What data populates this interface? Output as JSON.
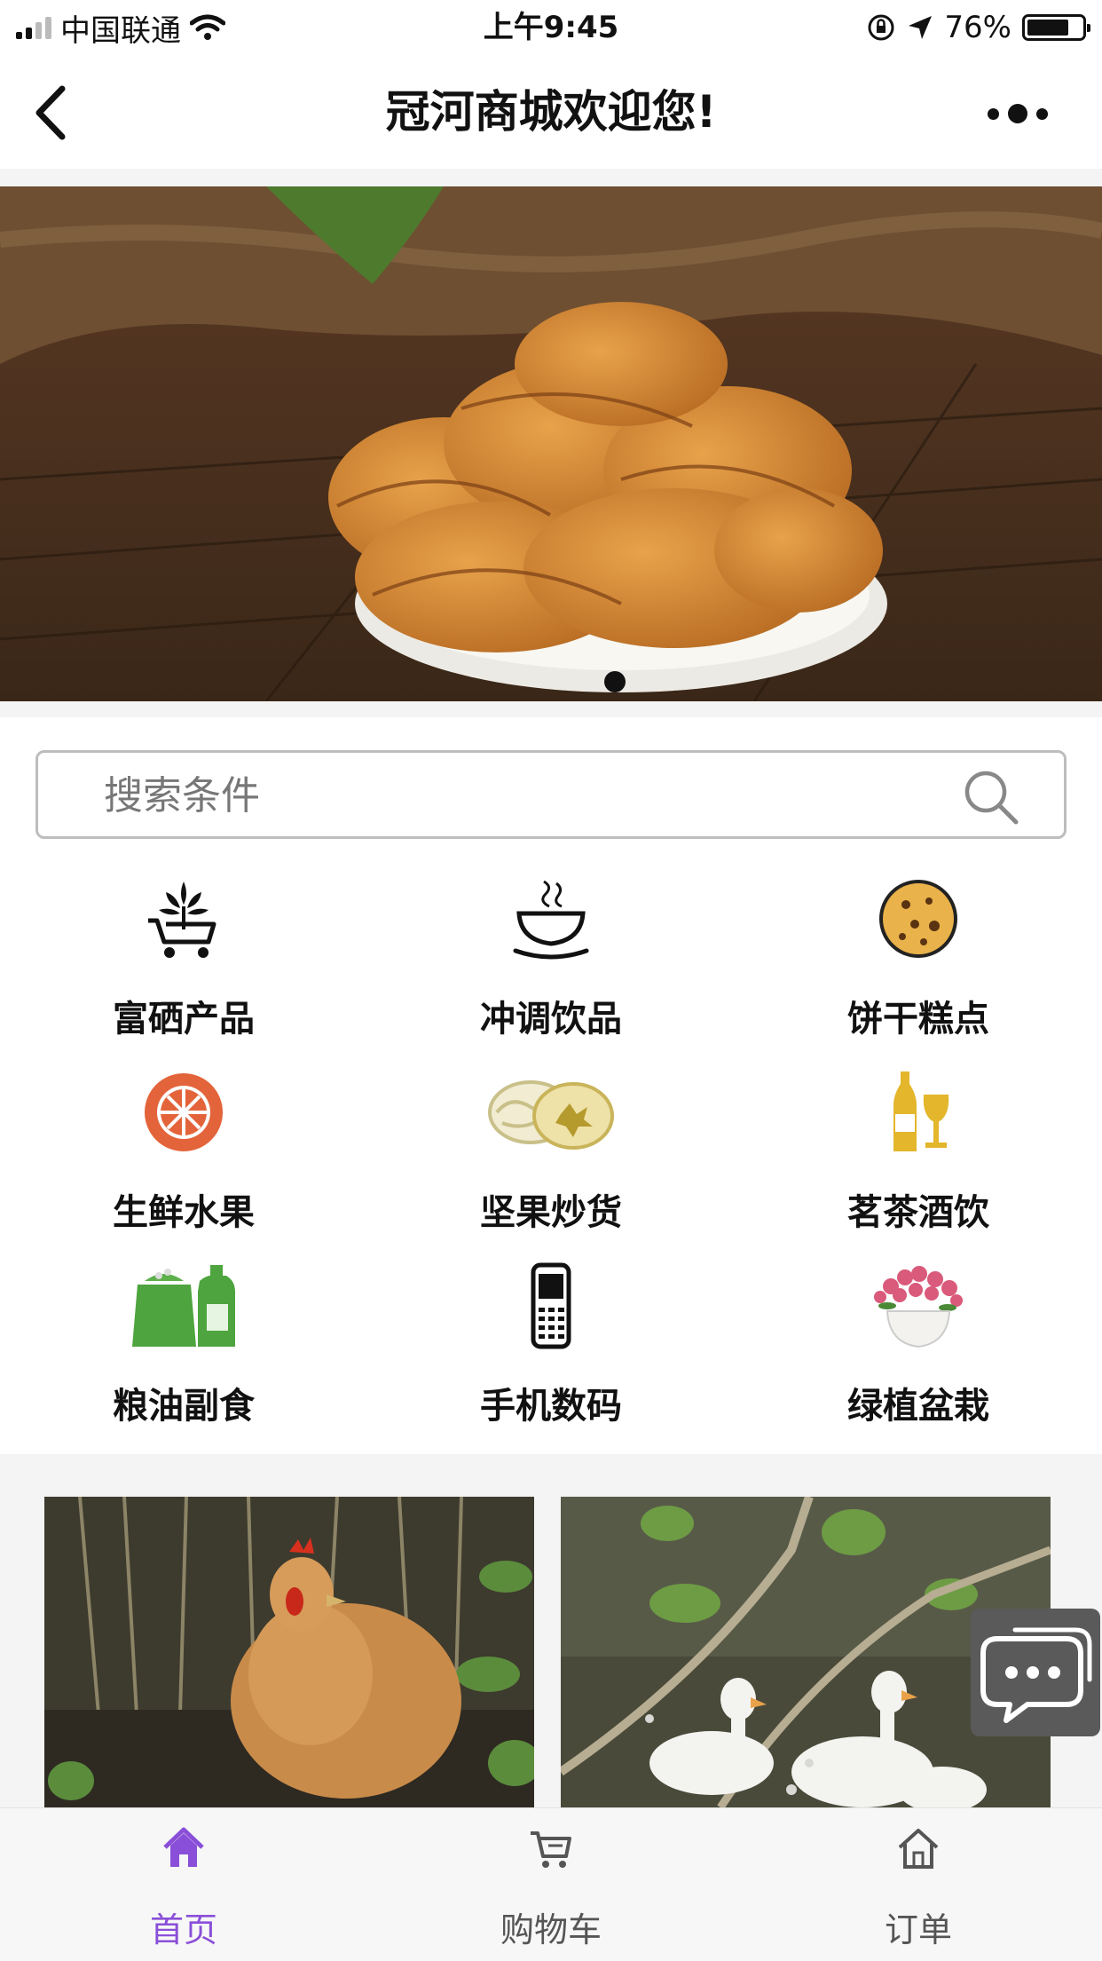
{
  "status_bar": {
    "carrier": "中国联通",
    "time": "上午9:45",
    "battery_percent": "76%",
    "battery_level": 0.76,
    "icons": [
      "signal-icon",
      "wifi-icon",
      "rotation-lock-icon",
      "location-arrow-icon",
      "battery-icon"
    ]
  },
  "nav": {
    "title": "冠河商城欢迎您!",
    "icons": [
      "back-chevron-icon",
      "more-dots-icon"
    ]
  },
  "banner": {
    "image": "sweet potato chips on plate",
    "slide_count": 1,
    "active_slide": 1
  },
  "search": {
    "placeholder": "搜索条件",
    "value": ""
  },
  "categories": [
    {
      "label": "富硒产品",
      "icon": "plant-cart-icon"
    },
    {
      "label": "冲调饮品",
      "icon": "coffee-cup-icon"
    },
    {
      "label": "饼干糕点",
      "icon": "cookie-icon"
    },
    {
      "label": "生鲜水果",
      "icon": "orange-slice-icon"
    },
    {
      "label": "坚果炒货",
      "icon": "walnut-icon"
    },
    {
      "label": "茗茶酒饮",
      "icon": "wine-bottle-glass-icon"
    },
    {
      "label": "粮油副食",
      "icon": "rice-bag-oil-icon"
    },
    {
      "label": "手机数码",
      "icon": "mobile-phone-icon"
    },
    {
      "label": "绿植盆栽",
      "icon": "potted-flower-icon"
    }
  ],
  "products": [
    {
      "image": "chicken in garden"
    },
    {
      "image": "white ducks in garden"
    }
  ],
  "tabs": [
    {
      "label": "首页",
      "icon": "home-icon",
      "active": true
    },
    {
      "label": "购物车",
      "icon": "cart-icon",
      "active": false
    },
    {
      "label": "订单",
      "icon": "order-house-icon",
      "active": false
    }
  ],
  "colors": {
    "accent": "#8a4fd8",
    "tab_inactive": "#555555",
    "background": "#f4f4f4"
  }
}
